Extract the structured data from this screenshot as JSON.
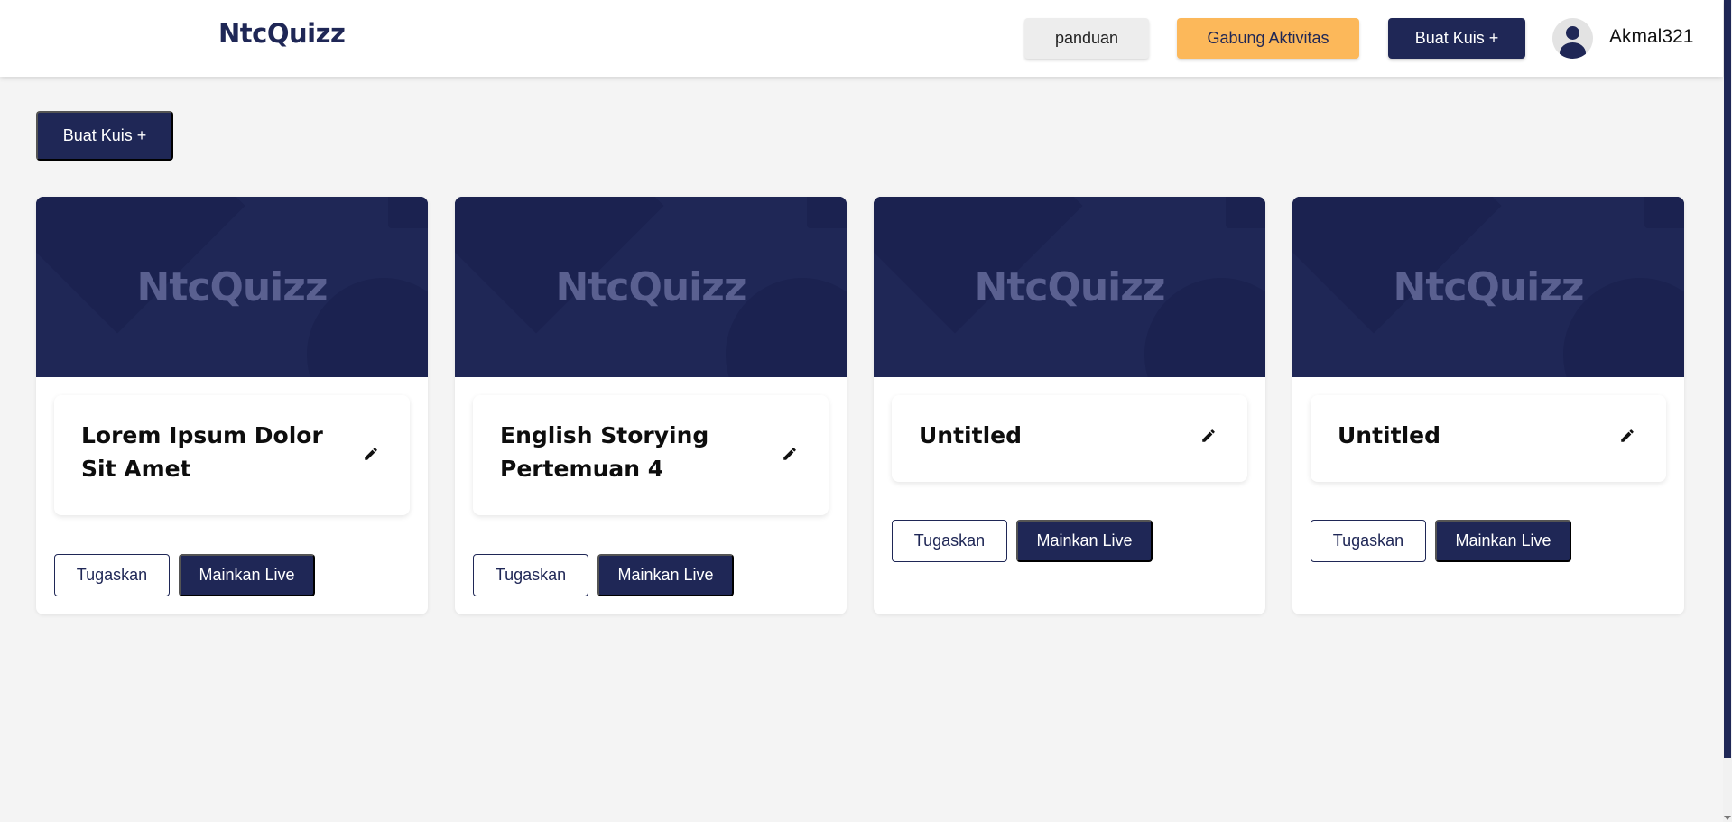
{
  "header": {
    "logo": "NtcQuizz",
    "guide_label": "panduan",
    "join_label": "Gabung Aktivitas",
    "create_label": "Buat Kuis +",
    "username": "Akmal321"
  },
  "main": {
    "create_label": "Buat Kuis +",
    "cards": [
      {
        "banner_text": "NtcQuizz",
        "title": "Lorem Ipsum Dolor Sit Amet",
        "assign_label": "Tugaskan",
        "play_label": "Mainkan Live"
      },
      {
        "banner_text": "NtcQuizz",
        "title": "English Storying Pertemuan 4",
        "assign_label": "Tugaskan",
        "play_label": "Mainkan Live"
      },
      {
        "banner_text": "NtcQuizz",
        "title": "Untitled",
        "assign_label": "Tugaskan",
        "play_label": "Mainkan Live"
      },
      {
        "banner_text": "NtcQuizz",
        "title": "Untitled",
        "assign_label": "Tugaskan",
        "play_label": "Mainkan Live"
      }
    ]
  },
  "colors": {
    "primary": "#1f2756",
    "accent": "#fcb85a",
    "background": "#f4f4f4"
  },
  "icons": {
    "edit": "pencil-icon",
    "avatar": "user-avatar-icon"
  }
}
